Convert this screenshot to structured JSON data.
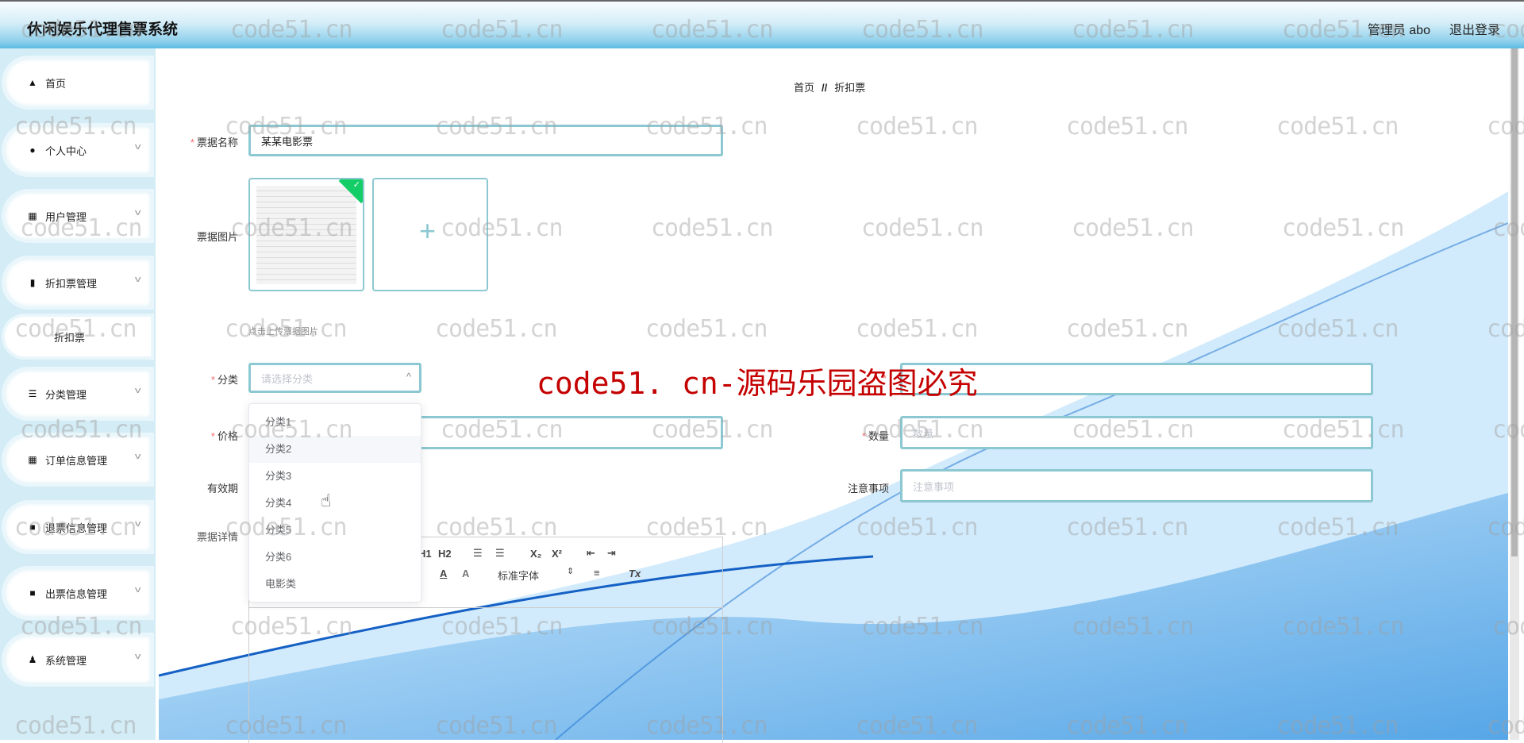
{
  "header": {
    "title": "休闲娱乐代理售票系统",
    "user": "管理员 abo",
    "logout": "退出登录"
  },
  "sidebar": {
    "items": [
      {
        "label": "首页",
        "icon": "home-icon"
      },
      {
        "label": "个人中心",
        "icon": "user-icon"
      },
      {
        "label": "用户管理",
        "icon": "grid-icon"
      },
      {
        "label": "折扣票管理",
        "icon": "book-icon"
      },
      {
        "label": "折扣票",
        "icon": ""
      },
      {
        "label": "分类管理",
        "icon": "list-icon"
      },
      {
        "label": "订单信息管理",
        "icon": "grid-icon"
      },
      {
        "label": "退票信息管理",
        "icon": "monitor-icon"
      },
      {
        "label": "出票信息管理",
        "icon": "printer-icon"
      },
      {
        "label": "系统管理",
        "icon": "admin-icon"
      }
    ]
  },
  "breadcrumb": {
    "home": "首页",
    "sep": "//",
    "current": "折扣票"
  },
  "form": {
    "name_label": "票据名称",
    "name_value": "某某电影票",
    "image_label": "票据图片",
    "image_hint": "点击上传票据图片",
    "category_label": "分类",
    "category_placeholder": "请选择分类",
    "price_label": "价格",
    "quantity_label": "数量",
    "quantity_placeholder": "数量",
    "validity_label": "有效期",
    "notes_label": "注意事项",
    "notes_placeholder": "注意事项",
    "detail_label": "票据详情"
  },
  "dropdown": {
    "options": [
      "分类1",
      "分类2",
      "分类3",
      "分类4",
      "分类5",
      "分类6",
      "电影类"
    ],
    "hovered": "分类2"
  },
  "editor": {
    "row1": [
      "H1",
      "H2",
      "ordered-list",
      "bullet-list",
      "X₂",
      "X²",
      "outdent",
      "indent"
    ],
    "font": "标准字体"
  },
  "watermark": {
    "text": "code51.cn",
    "banner": "code51. cn-源码乐园盗图必究"
  },
  "colors": {
    "input_border": "#8cc8d1",
    "header": "#5bbbe3",
    "sidebar": "#d3ecf5",
    "required": "#f56c6c",
    "banner": "#c40000"
  }
}
